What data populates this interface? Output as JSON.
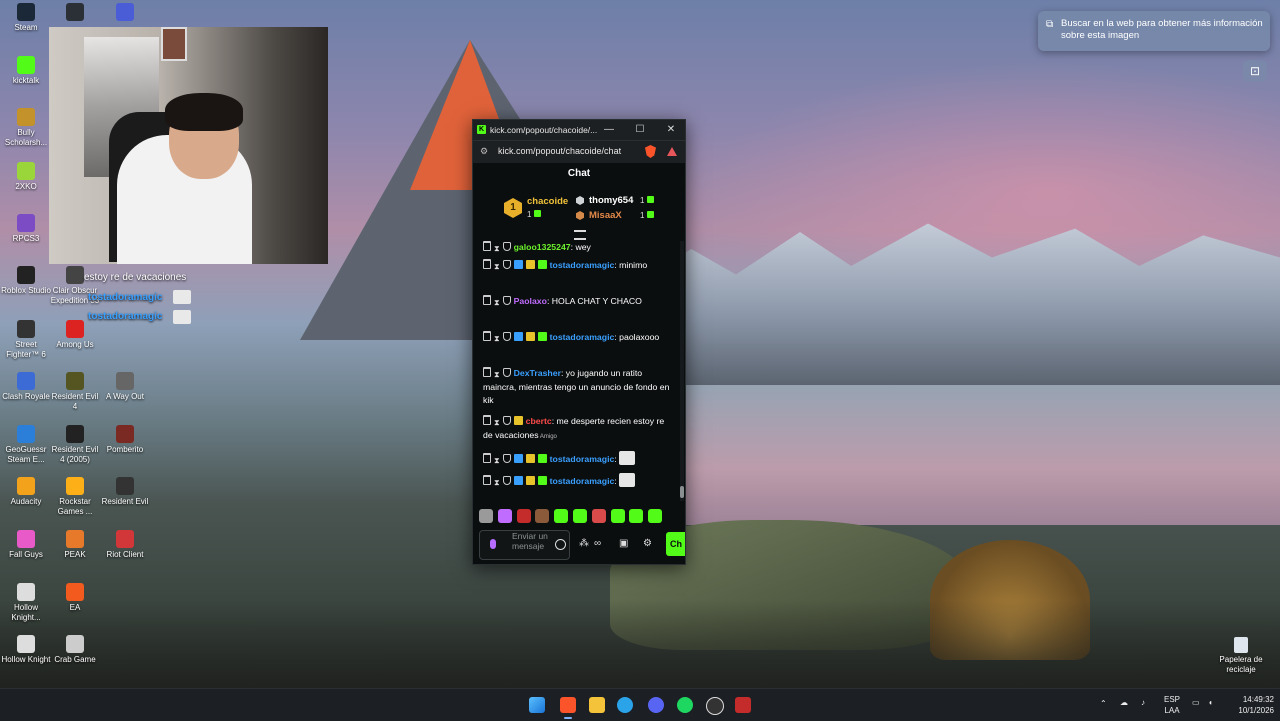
{
  "desktop": {
    "icons": [
      {
        "label": "Steam",
        "color": "#1b2838"
      },
      {
        "label": "",
        "color": "#2b2f36"
      },
      {
        "label": "",
        "color": "#4a5cd6"
      },
      {
        "label": "kicktalk",
        "color": "#53fc18"
      },
      {
        "label": "Bully Scholarsh...",
        "color": "#c4922a"
      },
      {
        "label": "2XKO",
        "color": "#9ad63a"
      },
      {
        "label": "RPCS3",
        "color": "#7b4cc4"
      },
      {
        "label": "Roblox Studio",
        "color": "#222"
      },
      {
        "label": "Clair Obscur Expedition 33",
        "color": "#444"
      },
      {
        "label": "Street Fighter™ 6",
        "color": "#333"
      },
      {
        "label": "Among Us",
        "color": "#d22"
      },
      {
        "label": "Clash Royale",
        "color": "#3c6bd6"
      },
      {
        "label": "Resident Evil 4",
        "color": "#552"
      },
      {
        "label": "A Way Out",
        "color": "#666"
      },
      {
        "label": "GeoGuessr Steam E...",
        "color": "#2b7fd8"
      },
      {
        "label": "Resident Evil 4 (2005)",
        "color": "#222"
      },
      {
        "label": "Pomberito",
        "color": "#7a2a22"
      },
      {
        "label": "Audacity",
        "color": "#f3a21b"
      },
      {
        "label": "Rockstar Games ...",
        "color": "#fcaf17"
      },
      {
        "label": "Resident Evil",
        "color": "#333"
      },
      {
        "label": "Fall Guys",
        "color": "#e85ac8"
      },
      {
        "label": "PEAK",
        "color": "#e77a2a"
      },
      {
        "label": "Riot Client",
        "color": "#d13639"
      },
      {
        "label": "Hollow Knight...",
        "color": "#ddd"
      },
      {
        "label": "EA",
        "color": "#f25a1e"
      },
      {
        "label": "Hollow Knight",
        "color": "#ddd"
      },
      {
        "label": "Crab Game",
        "color": "#ccc"
      }
    ],
    "recycle_bin": "Papelera de reciclaje"
  },
  "stream_overlay": {
    "line1": "estoy re de vacaciones",
    "line2": "tostadoramagic",
    "line3": "tostadoramagic"
  },
  "lens": {
    "text": "Buscar en la web para obtener más información sobre esta imagen"
  },
  "browser": {
    "title": "kick.com/popout/chacoide/...",
    "url": "kick.com/popout/chacoide/chat",
    "minimize": "—",
    "maximize": "☐",
    "close": "✕",
    "accent": "#53fc18"
  },
  "chat": {
    "header": "Chat",
    "leaderboard": {
      "rank": "1",
      "first": {
        "name": "chacoide",
        "count": "1"
      },
      "second": {
        "name": "thomy654",
        "count": "1"
      },
      "third": {
        "name": "MisaaX",
        "count": "1"
      }
    },
    "messages": [
      {
        "user": "galoo1325247",
        "color": "#6cf22c",
        "text": "wey"
      },
      {
        "user": "tostadoramagic",
        "color": "#3aa0ff",
        "text": "minimo"
      },
      {
        "user": "Paolaxo",
        "color": "#c06cff",
        "text": "HOLA CHAT Y CHACO"
      },
      {
        "user": "tostadoramagic",
        "color": "#3aa0ff",
        "text": "paolaxooo"
      },
      {
        "user": "DexTrasher",
        "color": "#3aa0ff",
        "text": "yo jugando un ratito maincra, mientras tengo un anuncio de fondo en kik"
      },
      {
        "user": "cbertc",
        "color": "#ff4b4b",
        "text": "me desperte recien estoy re de vacaciones",
        "tag": "Amigo"
      },
      {
        "user": "tostadoramagic",
        "color": "#3aa0ff",
        "text": ""
      },
      {
        "user": "tostadoramagic",
        "color": "#3aa0ff",
        "text": ""
      }
    ],
    "input_placeholder": "Enviar un mensaje",
    "send_label": "Ch"
  },
  "taskbar": {
    "language": "ESP",
    "layout": "LAA",
    "time": "14:49:32",
    "date": "10/1/2026"
  }
}
